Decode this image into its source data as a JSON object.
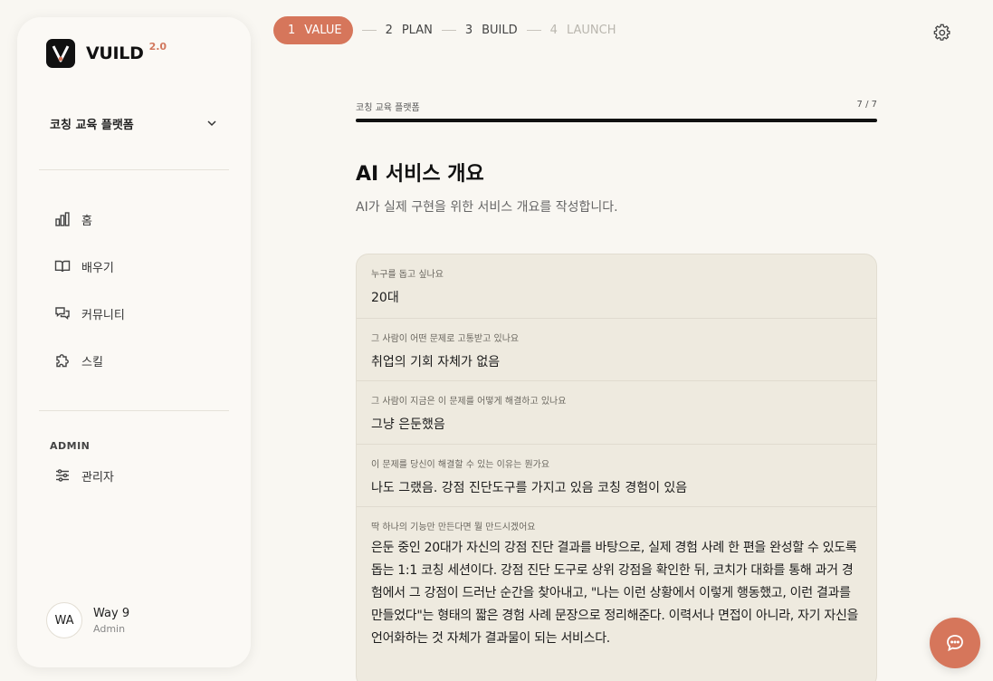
{
  "brand": {
    "name": "VUILD",
    "version": "2.0"
  },
  "project_selector": {
    "value": "코칭 교육 플랫폼"
  },
  "nav": {
    "items": [
      {
        "label": "홈",
        "icon": "bar-chart-icon"
      },
      {
        "label": "배우기",
        "icon": "book-icon"
      },
      {
        "label": "커뮤니티",
        "icon": "chat-bubbles-icon"
      },
      {
        "label": "스킬",
        "icon": "puzzle-icon"
      }
    ],
    "admin_title": "ADMIN",
    "admin_items": [
      {
        "label": "관리자",
        "icon": "sliders-icon"
      }
    ]
  },
  "user": {
    "initials": "WA",
    "name": "Way 9",
    "role": "Admin"
  },
  "stepper": {
    "steps": [
      {
        "num": "1",
        "label": "VALUE",
        "state": "active"
      },
      {
        "num": "2",
        "label": "PLAN",
        "state": "done"
      },
      {
        "num": "3",
        "label": "BUILD",
        "state": "done"
      },
      {
        "num": "4",
        "label": "LAUNCH",
        "state": "todo"
      }
    ]
  },
  "progress": {
    "label": "코칭 교육 플랫폼",
    "count": "7 / 7",
    "fraction": 1.0
  },
  "page": {
    "title": "AI 서비스 개요",
    "subtitle": "AI가 실제 구현을 위한 서비스 개요를 작성합니다."
  },
  "qa": [
    {
      "question": "누구를 돕고 싶나요",
      "answer": "20대"
    },
    {
      "question": "그 사람이 어떤 문제로 고통받고 있나요",
      "answer": "취업의 기회 자체가 없음"
    },
    {
      "question": "그 사람이 지금은 이 문제를 어떻게 해결하고 있나요",
      "answer": "그냥 은둔했음"
    },
    {
      "question": "이 문제를 당신이 해결할 수 있는 이유는 뭔가요",
      "answer": "나도 그랬음. 강점 진단도구를 가지고 있음 코칭 경험이 있음"
    },
    {
      "question": "딱 하나의 기능만 만든다면 뭘 만드시겠어요",
      "answer": "은둔 중인 20대가 자신의 강점 진단 결과를 바탕으로, 실제 경험 사례 한 편을 완성할 수 있도록 돕는 1:1 코칭 세션이다. 강점 진단 도구로 상위 강점을 확인한 뒤, 코치가 대화를 통해 과거 경험에서 그 강점이 드러난 순간을 찾아내고, \"나는 이런 상황에서 이렇게 행동했고, 이런 결과를 만들었다\"는 형태의 짧은 경험 사례 문장으로 정리해준다. 이력서나 면접이 아니라, 자기 자신을 언어화하는 것 자체가 결과물이 되는 서비스다."
    }
  ],
  "colors": {
    "accent": "#d6765b",
    "background": "#f9f7f2",
    "card": "#eeeadf"
  }
}
